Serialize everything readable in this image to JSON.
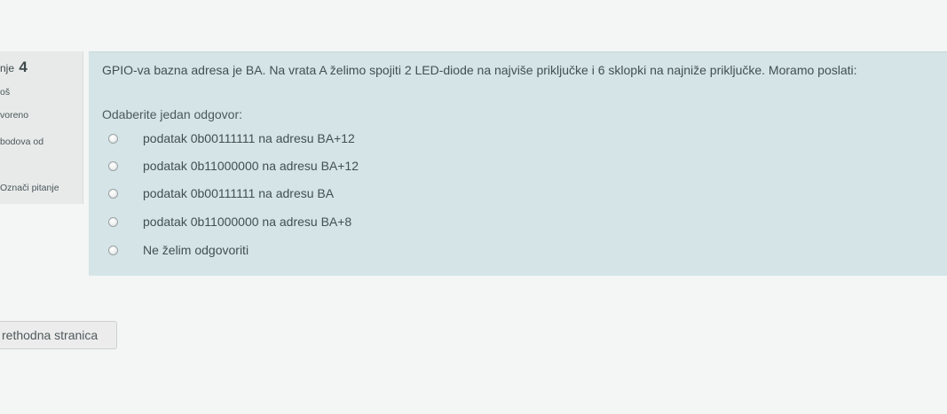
{
  "question_info": {
    "number_prefix": "nje",
    "number": "4",
    "status_line1": "oš",
    "status_line2": "voreno",
    "points_line": "bodova od",
    "flag_label": "Označi pitanje"
  },
  "question": {
    "text": "GPIO-va bazna adresa je BA. Na vrata A želimo spojiti 2 LED-diode na najviše priključke i 6 sklopki na najniže priključke. Moramo poslati:",
    "prompt": "Odaberite jedan odgovor:",
    "answers": [
      {
        "label": "podatak 0b00111111 na adresu BA+12",
        "selected": false
      },
      {
        "label": "podatak 0b11000000 na adresu BA+12",
        "selected": false
      },
      {
        "label": "podatak 0b00111111 na adresu BA",
        "selected": false
      },
      {
        "label": "podatak 0b11000000 na adresu BA+8",
        "selected": false
      },
      {
        "label": "Ne želim odgovoriti",
        "selected": false
      }
    ]
  },
  "navigation": {
    "prev_label": "rethodna stranica"
  }
}
